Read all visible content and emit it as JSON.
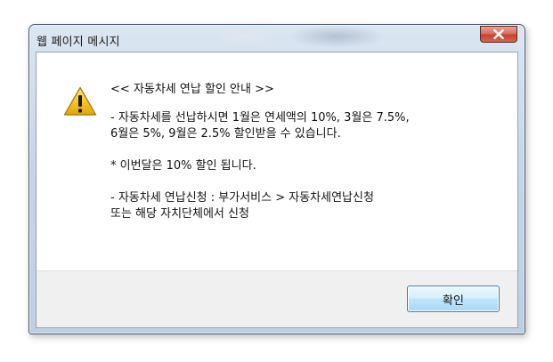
{
  "window": {
    "title": "웹 페이지 메시지",
    "close_label": "x"
  },
  "message": {
    "icon": "warning-icon",
    "heading": "<< 자동차세 연납 할인 안내 >>",
    "paragraph1": "- 자동차세를 선납하시면 1월은 연세액의 10%, 3월은 7.5%,\n6월은 5%, 9월은 2.5% 할인받을 수 있습니다.",
    "paragraph2": "* 이번달은 10% 할인 됩니다.",
    "paragraph3": "- 자동차세 연납신청 : 부가서비스 > 자동차세연납신청\n또는 해당 자치단체에서 신청"
  },
  "footer": {
    "ok_label": "확인"
  },
  "colors": {
    "warning_fill": "#f3c623",
    "close_button": "#c7412b",
    "ok_border": "#3c7fb1"
  }
}
